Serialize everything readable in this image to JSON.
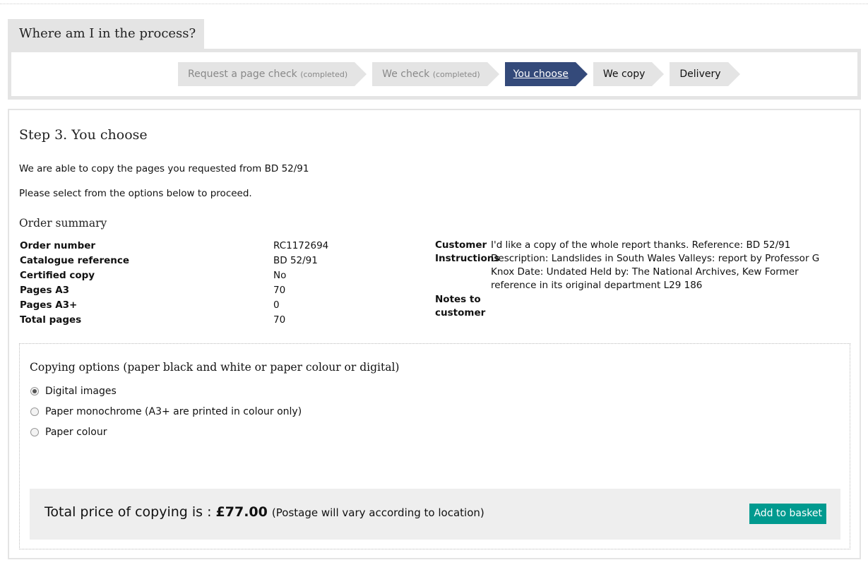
{
  "process": {
    "title": "Where am I in the process?",
    "steps": [
      {
        "label": "Request a page check",
        "note": "(completed)"
      },
      {
        "label": "We check",
        "note": "(completed)"
      },
      {
        "label": "You choose",
        "note": ""
      },
      {
        "label": "We copy",
        "note": ""
      },
      {
        "label": "Delivery",
        "note": ""
      }
    ]
  },
  "main": {
    "heading": "Step 3. You choose",
    "intro": "We are able to copy the pages you requested from BD 52/91",
    "instruction": "Please select from the options below to proceed.",
    "summary_title": "Order summary",
    "summary": [
      {
        "label": "Order number",
        "value": "RC1172694"
      },
      {
        "label": "Catalogue reference",
        "value": "BD 52/91"
      },
      {
        "label": "Certified copy",
        "value": "No"
      },
      {
        "label": "Pages A3",
        "value": "70"
      },
      {
        "label": "Pages A3+",
        "value": "0"
      },
      {
        "label": "Total pages",
        "value": "70"
      }
    ],
    "customer_instructions_label": "Customer Instructions",
    "customer_instructions": "I'd like a copy of the whole report thanks. Reference: BD 52/91 Description: Landslides in South Wales Valleys: report by Professor G Knox Date: Undated Held by: The National Archives, Kew Former reference in its original department L29 186",
    "notes_label": "Notes to customer",
    "notes": ""
  },
  "options": {
    "heading": "Copying options (paper black and white or paper colour or digital)",
    "choices": [
      {
        "label": "Digital images",
        "checked": true
      },
      {
        "label": "Paper monochrome (A3+ are printed in colour only)",
        "checked": false
      },
      {
        "label": "Paper colour",
        "checked": false
      }
    ],
    "price_prefix": "Total price of copying is : ",
    "price": "£77.00",
    "postage_note": "(Postage will vary according to location)",
    "basket_label": "Add to basket"
  },
  "colors": {
    "active_step": "#344a7a",
    "button": "#009a8f",
    "panel_grey": "#e4e4e4"
  }
}
